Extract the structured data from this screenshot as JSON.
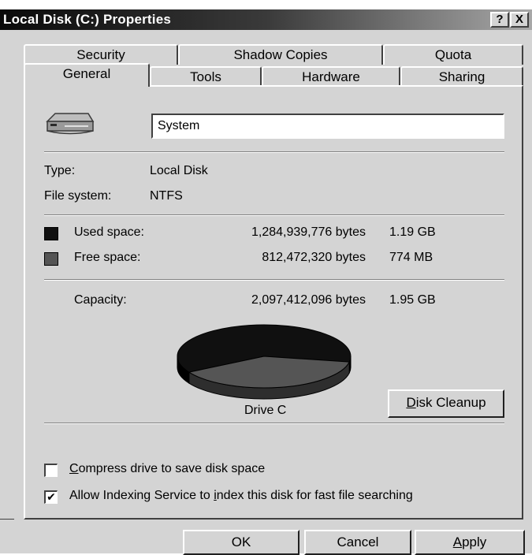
{
  "window": {
    "title": "Local Disk (C:) Properties",
    "help_label": "?",
    "close_label": "X"
  },
  "tabs_row1": [
    {
      "label": "Security"
    },
    {
      "label": "Shadow Copies"
    },
    {
      "label": "Quota"
    }
  ],
  "tabs_row2": [
    {
      "label": "General",
      "active": true
    },
    {
      "label": "Tools"
    },
    {
      "label": "Hardware"
    },
    {
      "label": "Sharing"
    }
  ],
  "general": {
    "drive_icon": "hard-drive-icon",
    "volume_name": "System",
    "type_label": "Type:",
    "type_value": "Local Disk",
    "filesystem_label": "File system:",
    "filesystem_value": "NTFS",
    "used_label": "Used space:",
    "used_bytes": "1,284,939,776 bytes",
    "used_size": "1.19 GB",
    "free_label": "Free space:",
    "free_bytes": "812,472,320 bytes",
    "free_size": "774 MB",
    "capacity_label": "Capacity:",
    "capacity_bytes": "2,097,412,096 bytes",
    "capacity_size": "1.95 GB",
    "drive_label": "Drive C",
    "disk_cleanup": {
      "accel": "D",
      "rest": "isk Cleanup"
    },
    "compress": {
      "checked": false,
      "accel": "C",
      "rest": "ompress drive to save disk space"
    },
    "indexing": {
      "checked": true,
      "pre": "Allow Indexing Service to ",
      "accel": "i",
      "rest": "ndex this disk for fast file searching"
    }
  },
  "colors": {
    "used": "#101010",
    "free": "#555555"
  },
  "chart_data": {
    "type": "pie",
    "categories": [
      "Used space",
      "Free space"
    ],
    "values": [
      1284939776,
      812472320
    ]
  },
  "footer": {
    "ok_label": "OK",
    "cancel_label": "Cancel",
    "apply": {
      "accel": "A",
      "rest": "pply"
    }
  }
}
